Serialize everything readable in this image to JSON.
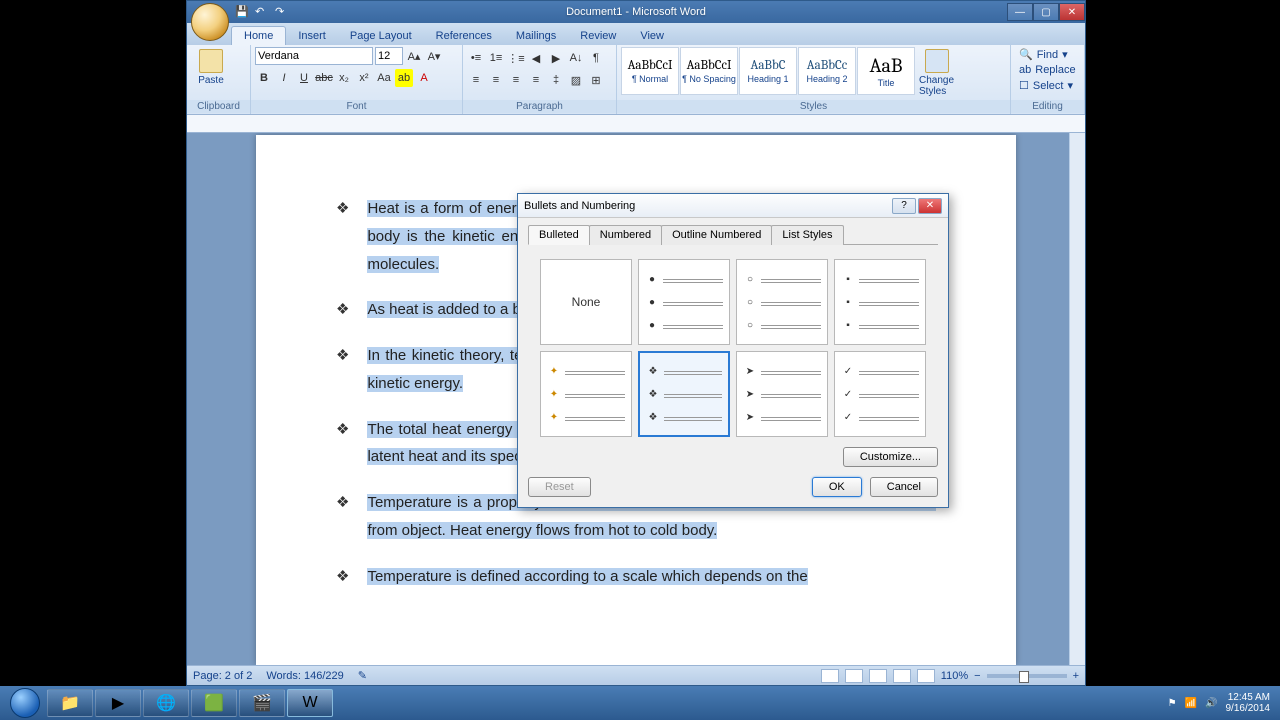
{
  "window": {
    "title": "Document1 - Microsoft Word"
  },
  "tabs": {
    "home": "Home",
    "insert": "Insert",
    "page_layout": "Page Layout",
    "references": "References",
    "mailings": "Mailings",
    "review": "Review",
    "view": "View"
  },
  "ribbon": {
    "clipboard": {
      "title": "Clipboard",
      "paste": "Paste"
    },
    "font": {
      "title": "Font",
      "family": "Verdana",
      "size": "12"
    },
    "paragraph": {
      "title": "Paragraph"
    },
    "styles": {
      "title": "Styles",
      "items": [
        "¶ Normal",
        "¶ No Spacing",
        "Heading 1",
        "Heading 2",
        "Title"
      ],
      "change": "Change Styles"
    },
    "editing": {
      "title": "Editing",
      "find": "Find",
      "replace": "Replace",
      "select": "Select"
    }
  },
  "document": {
    "bullets": [
      "Heat is a form of energy and may be measured in joules. The heat energy of a rigid body is the kinetic energy of the random thermal motion of many vibrations of its molecules.",
      "As heat is added to a body its molecules vibrate more vigorously and frequently.",
      "In the kinetic theory, temperature is interpreted as a measure of its average internal kinetic energy.",
      "The total heat energy of a body depends on its temperature, it's state and it's mass, latent heat and its specific heat capacity.",
      "Temperature is a property that determines the rate at which heat is transferred  to or from object. Heat energy flows from hot to cold body.",
      "Temperature is defined according to a scale which depends on the"
    ]
  },
  "dialog": {
    "title": "Bullets and Numbering",
    "tabs": {
      "bulleted": "Bulleted",
      "numbered": "Numbered",
      "outline": "Outline Numbered",
      "list_styles": "List Styles"
    },
    "none": "None",
    "customize": "Customize...",
    "reset": "Reset",
    "ok": "OK",
    "cancel": "Cancel"
  },
  "statusbar": {
    "page": "Page: 2 of 2",
    "words": "Words: 146/229",
    "zoom": "110%"
  },
  "system": {
    "time": "12:45 AM",
    "date": "9/16/2014"
  }
}
